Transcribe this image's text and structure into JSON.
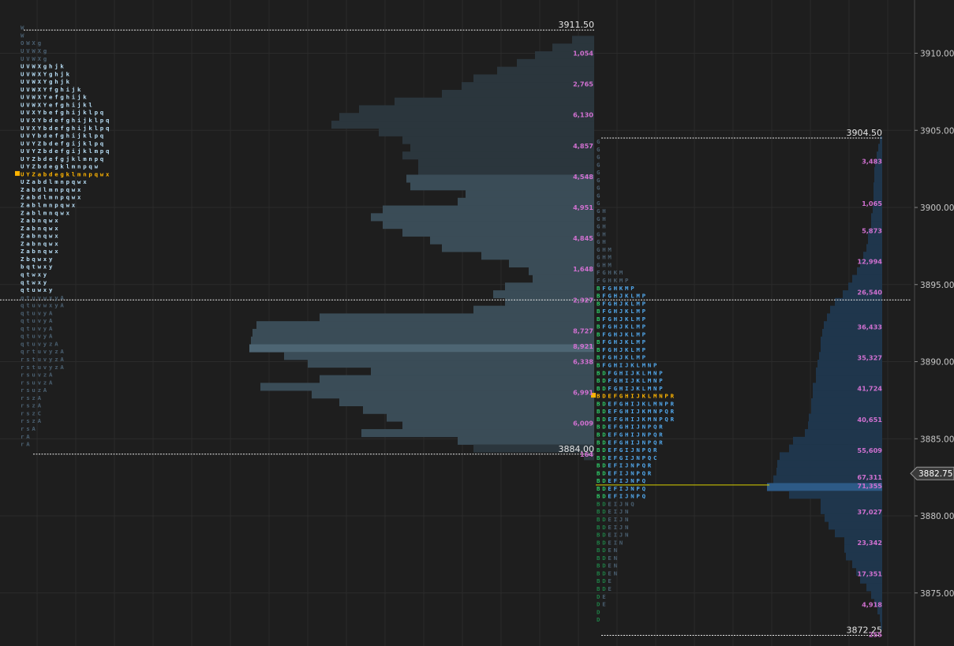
{
  "chart_data": {
    "type": "market_profile",
    "y_axis": {
      "ticks": [
        "3910.00",
        "3905.00",
        "3900.00",
        "3895.00",
        "3890.00",
        "3885.00",
        "3880.00",
        "3875.00"
      ],
      "range": [
        3872.25,
        3911.75
      ],
      "current_price": "3882.75"
    },
    "colors": {
      "background": "#1e1e1e",
      "grid": "#2b2b2b",
      "volume_bar_prior": "#2b363d",
      "volume_bar_hl": "#3a4c57",
      "volume_bar_poc": "#4d6573",
      "volume_bar_current": "#1f364c",
      "volume_bar_current_poc": "#2d5a86",
      "volume_label": "#d070d0",
      "poc_letters": "#ffb400",
      "tpo_blue": "#52a9ee",
      "tpo_light": "#b6dcf4",
      "tpo_dim": "#4a5f70",
      "tpo_green": "#2ec866",
      "tpo_green_dim": "#1e7e45",
      "level_line": "#e8e8e8",
      "poc_line": "#d8d000",
      "price_badge": "#3a3a3a"
    },
    "profiles": [
      {
        "name": "",
        "high": "3911.50",
        "low": "3884.00",
        "tpo_rows": [
          "W",
          "W",
          "OWXg",
          "UVWXg",
          "UVWXg",
          "UVWXghjk",
          "UVWXYghjk",
          "UVWXYghjk",
          "UVWXYfghijk",
          "UVWXYefghijk",
          "UVWXYefghijkl",
          "UVXYbefghijklpq",
          "UVXYbdefghijklpq",
          "UVXYbdefghijklpq",
          "UVYbdefghijklpq",
          "UVYZbdefgijklpq",
          "UVYZbdefgijklmpq",
          "UYZbdefgjklmnpq",
          "UYZbdegklmnpqw",
          "UYZabdegklmnpqwx",
          "UZabdlmnpqwx",
          "Zabdlmnpqwx",
          "Zabdlmnpqwx",
          "Zablmnpqwx",
          "Zablmnqwx",
          "Zabnqwx",
          "Zabnqwx",
          "Zabnqwx",
          "Zabnqwx",
          "Zabnqwx",
          "Zbqwxy",
          "bqtwxy",
          "qtwxy",
          "qtwxy",
          "qtuwxy",
          "qtuvwxyA",
          "qtuvwxyA",
          "qtuvyA",
          "qtuvyA",
          "qtuvyA",
          "qtuvyA",
          "qtuvyzA",
          "qrtuvyzA",
          "rstuvyzA",
          "rstuvyzA",
          "rsuvzA",
          "rsuvzA",
          "rsuzA",
          "rszA",
          "rszA",
          "rszC",
          "rszA",
          "rsA",
          "rA",
          "rA"
        ],
        "tpo_poc_row": 19,
        "volume_labels": [
          {
            "price": 3910.0,
            "text": "1,054"
          },
          {
            "price": 3908.0,
            "text": "2,765"
          },
          {
            "price": 3906.0,
            "text": "6,130"
          },
          {
            "price": 3904.0,
            "text": "4,857"
          },
          {
            "price": 3902.0,
            "text": "4,548"
          },
          {
            "price": 3900.0,
            "text": "4,951"
          },
          {
            "price": 3898.0,
            "text": "4,845"
          },
          {
            "price": 3896.0,
            "text": "1,648"
          },
          {
            "price": 3894.0,
            "text": "2,327"
          },
          {
            "price": 3892.0,
            "text": "8,727"
          },
          {
            "price": 3891.0,
            "text": "8,921"
          },
          {
            "price": 3890.0,
            "text": "6,338"
          },
          {
            "price": 3888.0,
            "text": "6,991"
          },
          {
            "price": 3886.0,
            "text": "6,009"
          },
          {
            "price": 3884.0,
            "text": "164"
          }
        ],
        "volume_poc_price": 3891.0
      },
      {
        "name": "",
        "high": "3904.50",
        "low": "3872.25",
        "tpo_rows": [
          "G",
          "G",
          "G",
          "G",
          "G",
          "G",
          "G",
          "G",
          "G",
          "GH",
          "GH",
          "GH",
          "GH",
          "GH",
          "GHM",
          "GHM",
          "GHM",
          "FGHKM",
          "FGHKMP",
          "BFGHKMP",
          "BFGHJKLMP",
          "BFGHJKLMP",
          "BFGHJKLMP",
          "BFGHJKLMP",
          "BFGHJKLMP",
          "BFGHJKLMP",
          "BFGHJKLMP",
          "BFGHJKLMP",
          "BFGHJKLMP",
          "BFGHIJKLMNP",
          "BDFGHIJKLMNP",
          "BDFGHIJKLMNP",
          "BDFGHIJKLMNP",
          "BDEFGHIJKLMNPR",
          "BDEFGHIJKLMNPR",
          "BDEFGHIJKMNPQR",
          "BDEFGHIJKMNPQR",
          "BDEFGHIJNPQR",
          "BDEFGHIJNPQR",
          "BDEFGHIJNPQR",
          "BDEFGIJNPQR",
          "BDEFGIJNPQC",
          "BDEFIJNPQR",
          "BDEFIJNPQR",
          "BDEFIJNPQ",
          "BDEFIJNPQ",
          "BDEFIJNPQ",
          "BDEIJNQ",
          "BDEIJN",
          "BDEIJN",
          "BDEIJN",
          "BDEIJN",
          "BDEIN",
          "BDEN",
          "BDEN",
          "BDEN",
          "BDEN",
          "BDE",
          "BDE",
          "DE",
          "DE",
          "D",
          "D"
        ],
        "tpo_poc_row": 33,
        "volume_labels": [
          {
            "price": 3903.0,
            "text": "3,483"
          },
          {
            "price": 3900.25,
            "text": "1,065"
          },
          {
            "price": 3898.5,
            "text": "5,873"
          },
          {
            "price": 3896.5,
            "text": "12,994"
          },
          {
            "price": 3894.5,
            "text": "26,540"
          },
          {
            "price": 3892.25,
            "text": "36,433"
          },
          {
            "price": 3890.25,
            "text": "35,327"
          },
          {
            "price": 3888.25,
            "text": "41,724"
          },
          {
            "price": 3886.25,
            "text": "40,651"
          },
          {
            "price": 3884.25,
            "text": "55,609"
          },
          {
            "price": 3882.5,
            "text": "67,311"
          },
          {
            "price": 3881.95,
            "text": "71,355"
          },
          {
            "price": 3880.25,
            "text": "37,027"
          },
          {
            "price": 3878.25,
            "text": "23,342"
          },
          {
            "price": 3876.25,
            "text": "17,351"
          },
          {
            "price": 3874.25,
            "text": "4,918"
          },
          {
            "price": 3872.3,
            "text": "255"
          }
        ],
        "volume_poc_price": 3882.0
      }
    ],
    "poc_line_price": 3882.0,
    "reference_line_price": 3894.0
  }
}
